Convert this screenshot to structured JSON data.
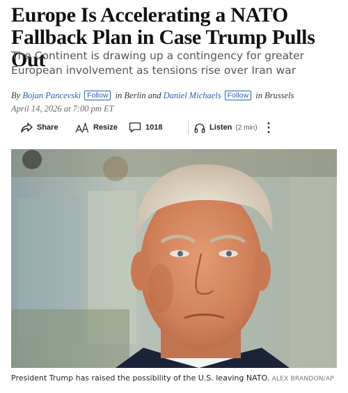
{
  "article": {
    "headline": "Europe Is Accelerating a NATO Fallback Plan in Case Trump Pulls Out",
    "dek": "The Continent is drawing up a contingency for greater European involvement as tensions rise over Iran war",
    "byline": {
      "prefix": "By",
      "author1": "Bojan Pancevski",
      "follow1": "Follow",
      "location1": "in Berlin and",
      "author2": "Daniel Michaels",
      "follow2": "Follow",
      "location2": "in Brussels"
    },
    "dateline": "April 14, 2026 at 7:00 pm ET"
  },
  "toolbar": {
    "share_label": "Share",
    "resize_label": "Resize",
    "comments_count": "1018",
    "listen_label": "Listen",
    "listen_duration": "(2 min)",
    "more_label": "⋮"
  },
  "photo": {
    "caption": "President Trump has raised the possibility of the U.S. leaving NATO.",
    "credit": "ALEX BRANDON/AP"
  },
  "icons": {
    "share": "share-icon",
    "resize": "resize-icon",
    "comments": "comment-icon",
    "listen": "headphones-icon",
    "more": "more-options-icon"
  }
}
